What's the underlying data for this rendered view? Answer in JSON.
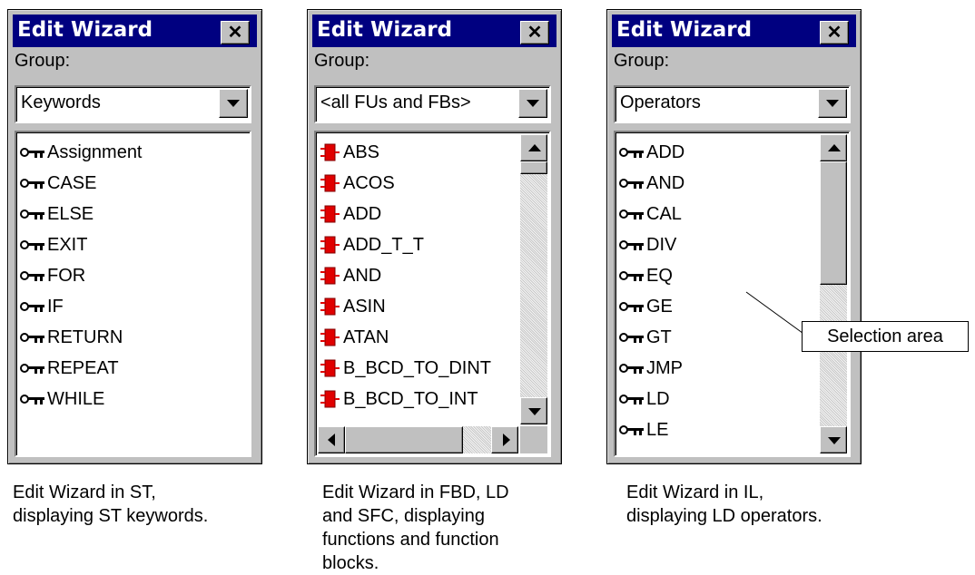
{
  "panels": [
    {
      "title": "Edit Wizard",
      "group_label": "Group:",
      "combo_value": "Keywords",
      "icon": "key-icon",
      "items": [
        "Assignment",
        "CASE",
        "ELSE",
        "EXIT",
        "FOR",
        "IF",
        "RETURN",
        "REPEAT",
        "WHILE"
      ],
      "caption": "Edit Wizard in ST,\ndisplaying ST keywords."
    },
    {
      "title": "Edit Wizard",
      "group_label": "Group:",
      "combo_value": "<all FUs and FBs>",
      "icon": "function-block-icon",
      "items": [
        "ABS",
        "ACOS",
        "ADD",
        "ADD_T_T",
        "AND",
        "ASIN",
        "ATAN",
        "B_BCD_TO_DINT",
        "B_BCD_TO_INT"
      ],
      "caption": "Edit Wizard in FBD, LD\nand SFC, displaying\nfunctions and function\nblocks."
    },
    {
      "title": "Edit Wizard",
      "group_label": "Group:",
      "combo_value": "Operators",
      "icon": "key-icon",
      "items": [
        "ADD",
        "AND",
        "CAL",
        "DIV",
        "EQ",
        "GE",
        "GT",
        "JMP",
        "LD",
        "LE"
      ],
      "caption": "Edit Wizard in IL,\ndisplaying LD operators."
    }
  ],
  "callout": {
    "label": "Selection area"
  },
  "colors": {
    "titlebar": "#000080",
    "window": "#c0c0c0",
    "fb_icon_red": "#e00000"
  }
}
